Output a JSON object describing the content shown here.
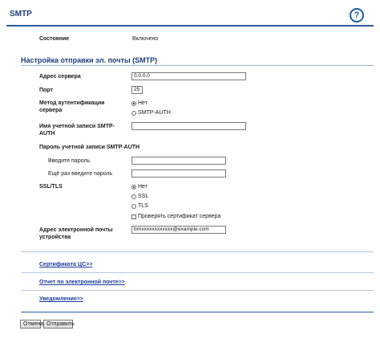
{
  "header": {
    "title": "SMTP",
    "help_icon": "?"
  },
  "status": {
    "label": "Состояние",
    "value": "Включено"
  },
  "section": {
    "title": "Настройка отправки эл. почты (SMTP)"
  },
  "fields": {
    "server_address": {
      "label": "Адрес сервера",
      "value": "0.0.0.0"
    },
    "port": {
      "label": "Порт",
      "value": "25"
    },
    "auth_method": {
      "label": "Метод аутентификации сервера",
      "options": [
        "Нет",
        "SMTP-AUTH"
      ],
      "selected": "Нет"
    },
    "smtp_account": {
      "label": "Имя учетной записи SMTP-AUTH",
      "value": ""
    },
    "smtp_password": {
      "label": "Пароль учетной записи SMTP-AUTH"
    },
    "enter_password": {
      "label": "Введите пароль",
      "value": ""
    },
    "reenter_password": {
      "label": "Ещё раз введите пароль",
      "value": ""
    },
    "ssl_tls": {
      "label": "SSL/TLS",
      "options": [
        "Нет",
        "SSL",
        "TLS"
      ],
      "selected": "Нет",
      "verify_label": "Проверять сертификат сервера"
    },
    "device_email": {
      "label": "Адрес электронной почты устройства",
      "value": "brnxxxxxxxxxxxx@example.com"
    }
  },
  "links": {
    "ca_certificate": "Сертификата ЦС>>",
    "email_report": "Отчет по электронной почте>>",
    "notification": "Уведомление>>"
  },
  "buttons": {
    "cancel": "Отмена",
    "send": "Отправить"
  }
}
